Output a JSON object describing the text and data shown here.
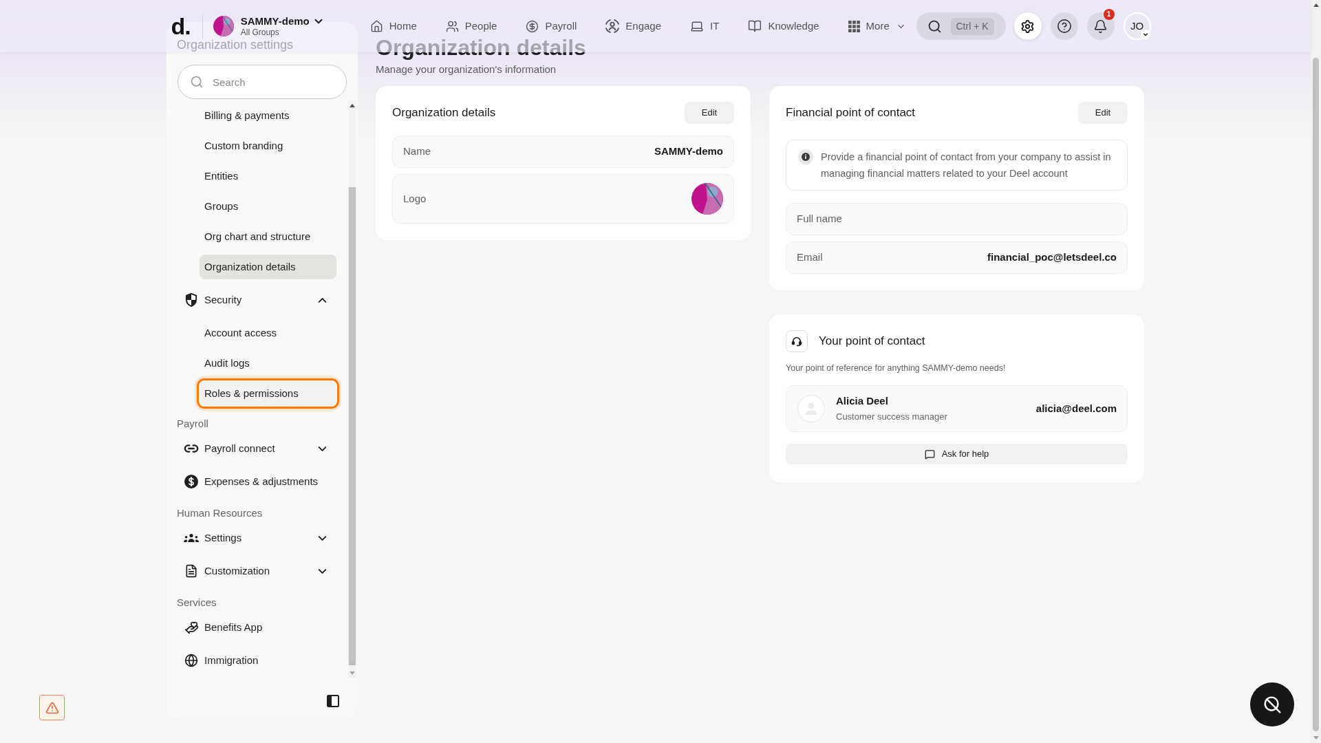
{
  "nav": {
    "logo": "d.",
    "org": {
      "name": "SAMMY-demo",
      "subtitle": "All Groups"
    },
    "items": [
      {
        "label": "Home",
        "kind": "link",
        "selected": false
      },
      {
        "label": "People",
        "kind": "link",
        "selected": false
      },
      {
        "label": "Payroll",
        "kind": "link",
        "selected": false
      },
      {
        "label": "Engage",
        "kind": "link",
        "selected": false
      },
      {
        "label": "IT",
        "kind": "link",
        "selected": false
      },
      {
        "label": "Knowledge",
        "kind": "link",
        "selected": false
      },
      {
        "label": "More",
        "kind": "dropdown",
        "selected": false
      }
    ],
    "search": {
      "shortcut": "Ctrl + K"
    },
    "icon_buttons": [
      {
        "kind": "settings",
        "selected": true
      },
      {
        "kind": "help",
        "selected": false
      },
      {
        "kind": "notifications",
        "selected": false,
        "badge": "1"
      }
    ],
    "account": {
      "initials": "JO"
    }
  },
  "sidebar": {
    "title": "Organization settings",
    "search": {
      "placeholder": "Search"
    },
    "entries": [
      {
        "kind": "item",
        "label": "Billing & payments",
        "selected": false,
        "highlighted": false
      },
      {
        "kind": "item",
        "label": "Custom branding",
        "selected": false,
        "highlighted": false
      },
      {
        "kind": "item",
        "label": "Entities",
        "selected": false,
        "highlighted": false
      },
      {
        "kind": "item",
        "label": "Groups",
        "selected": false,
        "highlighted": false
      },
      {
        "kind": "item",
        "label": "Org chart and structure",
        "selected": false,
        "highlighted": false
      },
      {
        "kind": "item",
        "label": "Organization details",
        "selected": true,
        "highlighted": false
      },
      {
        "kind": "group",
        "label": "Security",
        "selected": false,
        "expanded": true,
        "children": [
          {
            "label": "Account access",
            "selected": false,
            "highlighted": false
          },
          {
            "label": "Audit logs",
            "selected": false,
            "highlighted": false
          },
          {
            "label": "Roles & permissions",
            "selected": false,
            "highlighted": true
          }
        ]
      },
      {
        "kind": "heading",
        "label": "Payroll"
      },
      {
        "kind": "group",
        "label": "Payroll connect",
        "selected": false,
        "expanded": false
      },
      {
        "kind": "link",
        "label": "Expenses & adjustments",
        "selected": false
      },
      {
        "kind": "heading",
        "label": "Human Resources"
      },
      {
        "kind": "group",
        "label": "Settings",
        "selected": false,
        "expanded": false
      },
      {
        "kind": "group",
        "label": "Customization",
        "selected": false,
        "expanded": false
      },
      {
        "kind": "heading",
        "label": "Services"
      },
      {
        "kind": "link",
        "label": "Benefits App",
        "selected": false
      },
      {
        "kind": "link",
        "label": "Immigration",
        "selected": false
      }
    ]
  },
  "page": {
    "title": "Organization details",
    "subtitle": "Manage your organization's information"
  },
  "cards": [
    {
      "kind": "details",
      "title": "Organization details",
      "action": "Edit",
      "rows": [
        {
          "kind": "text",
          "label": "Name",
          "value": "SAMMY-demo"
        },
        {
          "kind": "logo",
          "label": "Logo"
        }
      ]
    },
    {
      "kind": "details",
      "title": "Financial point of contact",
      "action": "Edit",
      "notice": "Provide a financial point of contact from your company to assist in managing financial matters related to your Deel account",
      "rows": [
        {
          "kind": "text",
          "label": "Full name"
        },
        {
          "kind": "text",
          "label": "Email",
          "value": "financial_poc@letsdeel.co"
        }
      ]
    },
    {
      "kind": "contact",
      "title": "Your point of contact",
      "description": "Your point of reference for anything SAMMY-demo needs!",
      "contact": {
        "name": "Alicia Deel",
        "role": "Customer success manager",
        "email": "alicia@deel.com"
      },
      "action": "Ask for help"
    }
  ]
}
